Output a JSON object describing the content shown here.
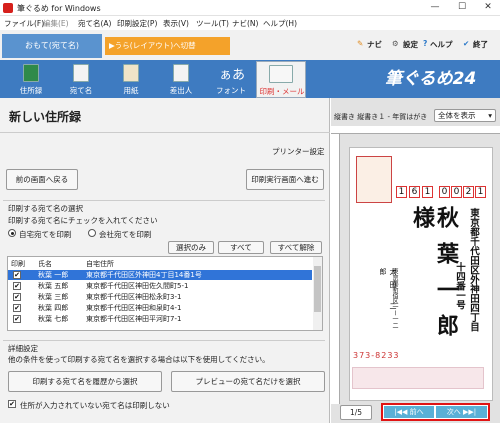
{
  "window": {
    "title": "筆ぐるめ for Windows",
    "minimize": "—",
    "maximize": "☐",
    "close": "✕"
  },
  "menu": [
    "ファイル(F)",
    "編集(E)",
    "宛て名(A)",
    "印刷設定(P)",
    "表示(V)",
    "ツール(T)",
    "ナビ(N)",
    "ヘルプ(H)"
  ],
  "mode": {
    "omote": "おもて(宛て名)",
    "ura": "▶うら(レイアウト)へ切替"
  },
  "tools": {
    "navi": "ナビ",
    "settings": "設定",
    "help": "ヘルプ",
    "exit": "終了"
  },
  "ribbon": [
    "住所録",
    "宛て名",
    "用紙",
    "差出人",
    "フォント",
    "印刷・メール"
  ],
  "logo": "筆ぐるめ24",
  "left": {
    "title": "新しい住所録",
    "printer": "プリンター設定",
    "back": "前の画面へ戻る",
    "next": "印刷実行画面へ進む",
    "section": "印刷する宛て名の選択",
    "instruction": "印刷する宛て名にチェックを入れてください",
    "radio_home": "自宅宛てを印刷",
    "radio_company": "会社宛てを印刷",
    "btn_select_only": "選択のみ",
    "btn_all": "すべて",
    "btn_clear_all": "すべて解除",
    "headers": [
      "印刷",
      "氏名",
      "自宅住所"
    ],
    "rows": [
      {
        "name": "秋葉 一郎",
        "address": "東京都千代田区外神田4丁目14番1号",
        "checked": "✔"
      },
      {
        "name": "秋葉 五郎",
        "address": "東京都千代田区神田佐久間町5-1",
        "checked": "✔"
      },
      {
        "name": "秋葉 三郎",
        "address": "東京都千代田区神田松永町3-1",
        "checked": "✔"
      },
      {
        "name": "秋葉 四郎",
        "address": "東京都千代田区神田和泉町4-1",
        "checked": "✔"
      },
      {
        "name": "秋葉 七郎",
        "address": "東京都千代田区神田平河町7-1",
        "checked": "✔"
      }
    ],
    "details_title": "詳細設定",
    "details_desc": "他の条件を使って印刷する宛て名を選択する場合は以下を使用してください。",
    "btn_history": "印刷する宛て名を履歴から選択",
    "btn_preview": "プレビューの宛て名だけを選択",
    "no_address_check": "✔",
    "no_address_label": "住所が入力されていない宛て名は印刷しない"
  },
  "right": {
    "orientation": "縦書き 縦書き１ - 年賀はがき",
    "zoom": "全体を表示",
    "postal": [
      "1",
      "6",
      "1",
      "0",
      "0",
      "2",
      "1"
    ],
    "addr_col1": "東京都千代田区外神田四丁目",
    "addr_col2": "十四番一号",
    "recipient": "秋葉一郎様",
    "sender": "太田 二郎",
    "sender_addr": "東京都新宿区一ー一二",
    "sender_postal": "373-8233",
    "page": "1/5",
    "prev": "前へ",
    "next": "次へ"
  }
}
